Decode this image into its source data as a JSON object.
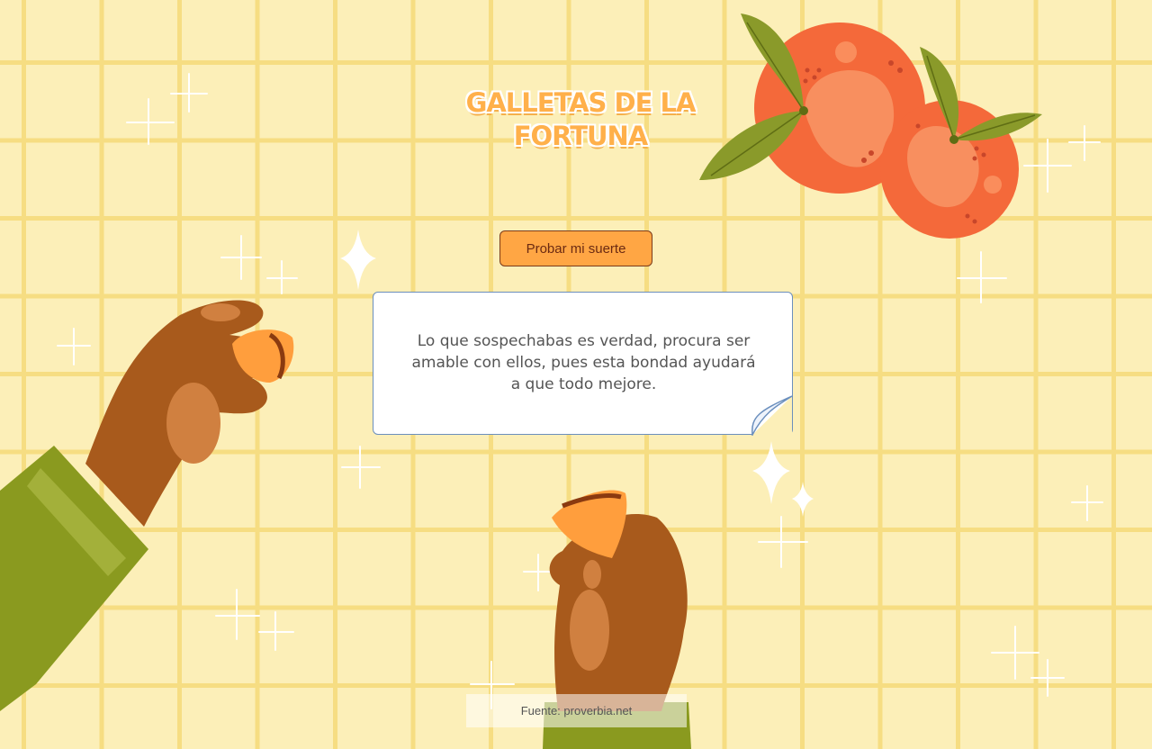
{
  "header": {
    "title_line1": "GALLETAS DE LA",
    "title_line2": "FORTUNA"
  },
  "action": {
    "button_label": "Probar mi suerte"
  },
  "fortune": {
    "message": "Lo que sospechabas es verdad, procura ser amable con ellos, pues esta bondad ayudará a que todo mejore."
  },
  "footer": {
    "source": "Fuente: proverbia.net"
  },
  "colors": {
    "background": "#fcefb8",
    "grid": "#f6dd82",
    "title": "#ffb04a",
    "button": "#ffa644",
    "orange_fruit": "#f4693a",
    "leaf": "#8a9a2a"
  },
  "icons": [
    "orange-fruit-icon",
    "sparkle-icon",
    "hand-holding-cookie-icon",
    "folded-corner-icon"
  ]
}
